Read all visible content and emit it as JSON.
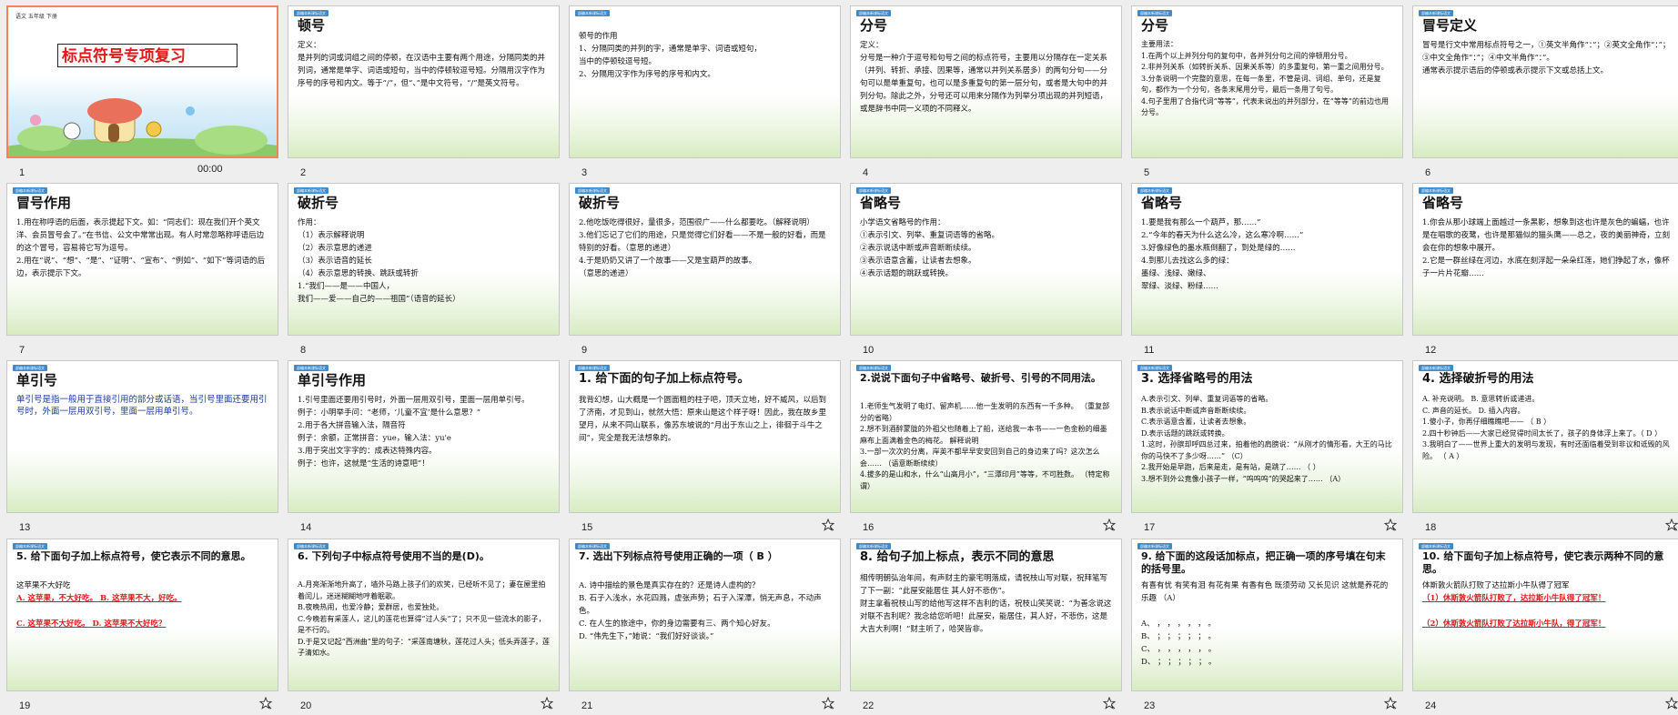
{
  "window": {
    "time": "00:00"
  },
  "slides": [
    {
      "n": "1",
      "tag": "",
      "title": "标点符号专项复习",
      "small": "语文  五年级  下册",
      "body": ""
    },
    {
      "n": "2",
      "tag": "部编本新课标语文",
      "title": "顿号",
      "body": "定义：\n      是并列的词或词组之间的停顿，在汉语中主要有两个用途，分隔同类的并列词，通常是单字、词语或短句，当中的停顿较逗号短。分隔用汉字作为序号的序号和内文。等于“/”，但“、”是中文符号，“/”是英文符号。"
    },
    {
      "n": "3",
      "tag": "部编本新课标语文",
      "title": "",
      "body": "顿号的作用\n1、分隔同类的并列的字，通常是单字、词语或短句，\n     当中的停顿较逗号短。\n2、分隔用汉字作为序号的序号和内文。"
    },
    {
      "n": "4",
      "tag": "部编本新课标语文",
      "title": "分号",
      "body": "定义：\n分号是一种介于逗号和句号之间的标点符号，主要用以分隔存在一定关系（并列、转折、承接、因果等，通常以并列关系居多）的两句分句——分句可以是单重复句，也可以是多重复句的第一层分句，或者是大句中的并列分句。除此之外，分号还可以用来分隔作为列举分项出现的并列短语，或是辞书中同一义项的不同释义。"
    },
    {
      "n": "5",
      "tag": "部编本新课标语文",
      "title": "分号",
      "body": "主要用法：\n1.在两个以上并列分句的复句中，各并列分句之间的停顿用分号。\n2.非并列关系（如转折关系、因果关系等）的多重复句，第一重之间用分号。\n3.分条说明一个完整的意思，在每一条里，不管是词、词组、单句，还是复句，都作为一个分句，各条末尾用分号，最后一条用了句号。\n4.句子里用了合指代词“等等”，代表未说出的并列部分，在“等等”的前边也用分号。"
    },
    {
      "n": "6",
      "tag": "部编本新课标语文",
      "title": "冒号定义",
      "body": "冒号是行文中常用标点符号之一，①英文半角作“：”；②英文全角作“：”；③中文全角作“：”；④中文半角作“：”。\n通常表示提示语后的停顿或表示提示下文或总括上文。"
    },
    {
      "n": "7",
      "tag": "部编本新课标语文",
      "title": "冒号作用",
      "body": "1.用在称呼语的后面，表示提起下文。如：“同志们：现在我们开个英文洋、会员冒号会了。”在书信、公文中常常出现。有人时常忽略称呼语后边的这个冒号，容易将它写为逗号。\n2.用在“说”、“想”、“是”、“证明”、“宣布”、“例如”、“如下”等词语的后边，表示提示下文。"
    },
    {
      "n": "8",
      "tag": "部编本新课标语文",
      "title": "破折号",
      "body": "作用：\n（1）表示解释说明\n（2）表示意思的递进\n（3）表示语音的延长\n（4）表示意思的转换、跳跃或转折\n1.“我们——是——中国人，\n   我们——爱——自己的——祖国”（语音的延长）"
    },
    {
      "n": "9",
      "tag": "部编本新课标语文",
      "title": "破折号",
      "body": "2.他吃饭吃得很好，量很多，范围很广——什么都要吃。（解释说明）\n3.他们忘记了它们的用途，只是觉得它们好看——不是一般的好看，而是特别的好看。（意思的递进）\n4.于是奶奶又讲了一个故事——又是宝葫芦的故事。\n（意思的递进）"
    },
    {
      "n": "10",
      "tag": "部编本新课标语文",
      "title": "省略号",
      "body": "小学语文省略号的作用：\n①表示引文、列举、重复词语等的省略。\n②表示说话中断或声音断断续续。\n③表示语意含蓄，让读者去想象。\n④表示话题的跳跃或转换。"
    },
    {
      "n": "11",
      "tag": "部编本新课标语文",
      "title": "省略号",
      "body": "1.要是我有那么一个葫芦，那……”\n2.“今年的春天为什么这么冷，这么寒冷啊……”\n3.好像绿色的墨水瓶倒翻了，到处是绿的……\n4.到那儿去找这么多的绿：\n墨绿、浅绿、嫩绿、\n翠绿、淡绿、粉绿……"
    },
    {
      "n": "12",
      "tag": "部编本新课标语文",
      "title": "省略号",
      "body": "1.你会从那小球端上面越过一条黑影，想象到这也许是灰色的蝙蝠，也许是在唱歌的夜鹭，也许是那猫似的猫头鹰——总之，夜的美丽神奇，立刻会在你的想象中展开。\n2.它是一群丝绿在河边，水底在刻浮起一朵朵红莲，她们挣起了水，像杯子一片片花瓣……"
    },
    {
      "n": "13",
      "tag": "部编本新课标语文",
      "title": "单引号",
      "body": "单引号是指一般用于直接引用的部分或话语，当引号里面还要用引号时，外面一层用双引号，里面一层用单引号。"
    },
    {
      "n": "14",
      "tag": "部编本新课标语文",
      "title": "单引号作用",
      "body": "1.引号里面还要用引号时，外面一层用双引号，里面一层用单引号。\n   例子：小明举手问：“老师，‘儿童不宜’是什么意思？”\n2.用于各大拼音输入法，隔音符\n   例子：余额，正常拼音：yue，输入法：yu'e\n3.用于突出文字字的：成表达特殊内容。\n   例子：也许，这就是“生活的诗意吧”！"
    },
    {
      "n": "15",
      "tag": "部编本新课标语文",
      "title": "1. 给下面的句子加上标点符号。",
      "body": "我背幻想，山大概是一个圆面粗的柱子吧，顶天立地，好不威风，以后到了济南，才见到山，就然大悟：原来山是这个样子呀！因此，我在故乡里望月，从来不同山联系，像苏东坡说的“月出于东山之上，徘徊于斗牛之间”，完全是我无法想象的。"
    },
    {
      "n": "16",
      "tag": "部编本新课标语文",
      "title": "2.说说下面句子中省略号、破折号、引号的不同用法。",
      "body": "1.老师生气发明了电灯、留声机……他一生发明的东西有一千多种。 （重复部分的省略）\n2.想不到酒醉蒙胧的外祖父也随着上了船，送给我一本书——一色金粉的细墨麻布上面满着金色的梅花。 解释说明\n3.一部一次次的分离，岸英不都早早安安回到自己的身边来了吗？这次怎么会…… （语意断断续续）\n4.拔多的是山和水，什么“山高月小”，“三潭印月”等等，不可胜数。 （特定称谓）"
    },
    {
      "n": "17",
      "tag": "部编本新课标语文",
      "title": "3. 选择省略号的用法",
      "body": "A.表示引文、列举、重复词语等的省略。\nB.表示说话中断或声音断断续续。\nC.表示语意含蓄，让读者去想象。\nD.表示话题的跳跃或转换。\n1.这时，孙膑却呼四总过来，拍着他的肩膀说：“从刚才的情形看，大王的马比你的马快不了多少呀……”  （C）\n2.我开始是早跑，后来是走，是有站，是跳了……   （  ）\n3.想不到外公竟像小孩子一样，“呜呜呜”的哭起来了……  （A）"
    },
    {
      "n": "18",
      "tag": "部编本新课标语文",
      "title": "4. 选择破折号的用法",
      "body": "A. 补充说明。    B. 意思转折或递进。\nC. 声音的延长。    D. 插入内容。\n1.傻小子，你再仔细瞧瞧吧——      （ B ）\n2.四十秒钟后——大家已经觉得时间太长了，孩子的身体浮上来了。（ D ）\n3.我明白了——世界上重大的发明与发现，有时还面临着受到非议和诋毁的风险。   （ A ）"
    },
    {
      "n": "19",
      "tag": "部编本新课标语文",
      "title": "5. 给下面句子加上标点符号，使它表示不同的意思。",
      "body": "这苹果不大好吃\nA. 这苹果，不大好吃。      B. 这苹果不大，好吃。\n\nC. 这苹果不大好吃。      D. 这苹果不大好吃？"
    },
    {
      "n": "20",
      "tag": "部编本新课标语文",
      "title": "6. 下列句子中标点符号使用不当的是(D)。",
      "body": "A.月亮渐渐地升高了，墙外马路上孩子们的欢笑，已经听不见了；妻在屋里拍着闰儿，迷迷糊糊地哼着眠歌。\nB.夜晚热闹，也爱冷静；爱群居，也爱独处。\nC.今晚若有采莲人，这儿的莲花也算得“过人头”了；只不见一些流水的影子，是不行的。\nD.于是又记起“西洲曲”里的句子：“采莲南塘秋，莲花过人头；低头弄莲子，莲子清如水。"
    },
    {
      "n": "21",
      "tag": "部编本新课标语文",
      "title": "7. 选出下列标点符号使用正确的一项（ B ）",
      "body": "A. 诗中描绘的景色是真实存在的？还是诗人虚构的？\nB. 石子入浅水，水花四溅，虚张声势；石子入深潭，悄无声息，不动声色。\nC. 在人生的旅途中，你的身边需要有三、两个知心好友。\nD. “伟先生下，”她说：“我们好好谈谈。”"
    },
    {
      "n": "22",
      "tag": "部编本新课标语文",
      "title": "8. 给句子加上标点，表示不同的意思",
      "body": "相传明朝弘治年间，有声财主的豪宅明落成，请祝枝山写对联，祝拜笔写了下一副：“此屋安能居住 其人好不悲伤”。\n财主拿着祝枝山写的给他写这样不吉利的话，祝枝山笑笑说：“为善念说这对联不吉利呢？我念给您听吧！此屋安，能居住，其人好，不悲伤，这是大吉大利啊！”财主听了，哈哭皆非。"
    },
    {
      "n": "23",
      "tag": "部编本新课标语文",
      "title": "9. 给下面的这段话加标点，把正确一项的序号填在句末的括号里。",
      "body": "有喜有忧 有笑有泪 有花有果 有香有色 既须劳动 又长见识 这就是养花的乐趣  （A）\n\nA、  ，  ，  ，  ，  ，  。\nB、  ；  ；  ；  ；  ；  。\nC、  ，  ，  ，  ，  ，  。\nD、  ；  ；  ；  ；  ；  。"
    },
    {
      "n": "24",
      "tag": "部编本新课标语文",
      "title": "10. 给下面句子加上标点符号，使它表示两种不同的意思。",
      "body": "体斯敦火箭队打败了达拉斯小牛队得了冠军\n（1）休斯敦火箭队打败了，达拉斯小牛队得了冠军！\n\n（2）休斯敦火箭队打败了达拉斯小牛队，得了冠军！"
    }
  ]
}
